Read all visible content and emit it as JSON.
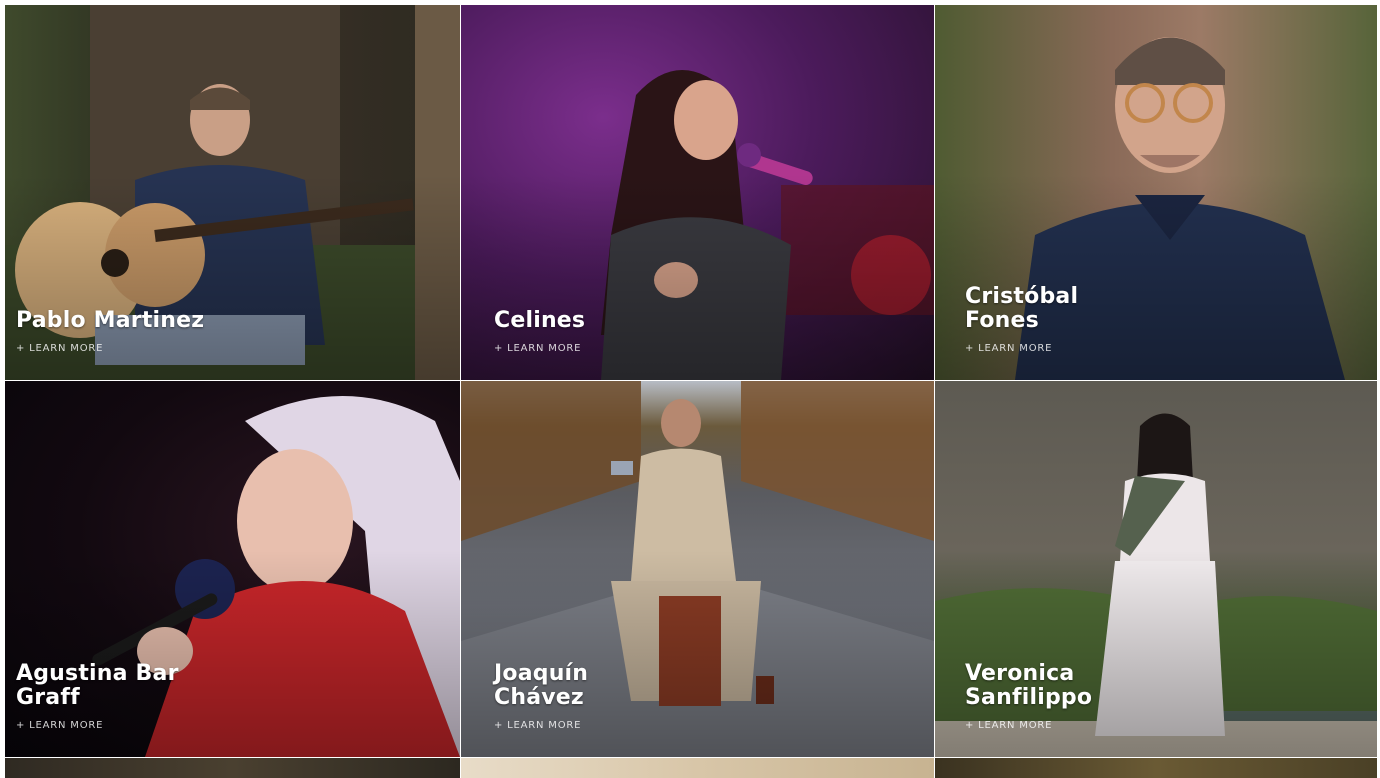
{
  "artists": [
    {
      "name": "Pablo Martinez",
      "link": "+ LEARN MORE"
    },
    {
      "name": "Celines",
      "link": "+ LEARN MORE"
    },
    {
      "name": "Cristóbal Fones",
      "link": "+ LEARN MORE"
    },
    {
      "name": "Agustina Bar Graff",
      "link": "+ LEARN MORE"
    },
    {
      "name": "Joaquín Chávez",
      "link": "+ LEARN MORE"
    },
    {
      "name": "Veronica Sanfilippo",
      "link": "+ LEARN MORE"
    }
  ],
  "colors": {
    "text": "#ffffff",
    "page_background": "#ffffff"
  }
}
